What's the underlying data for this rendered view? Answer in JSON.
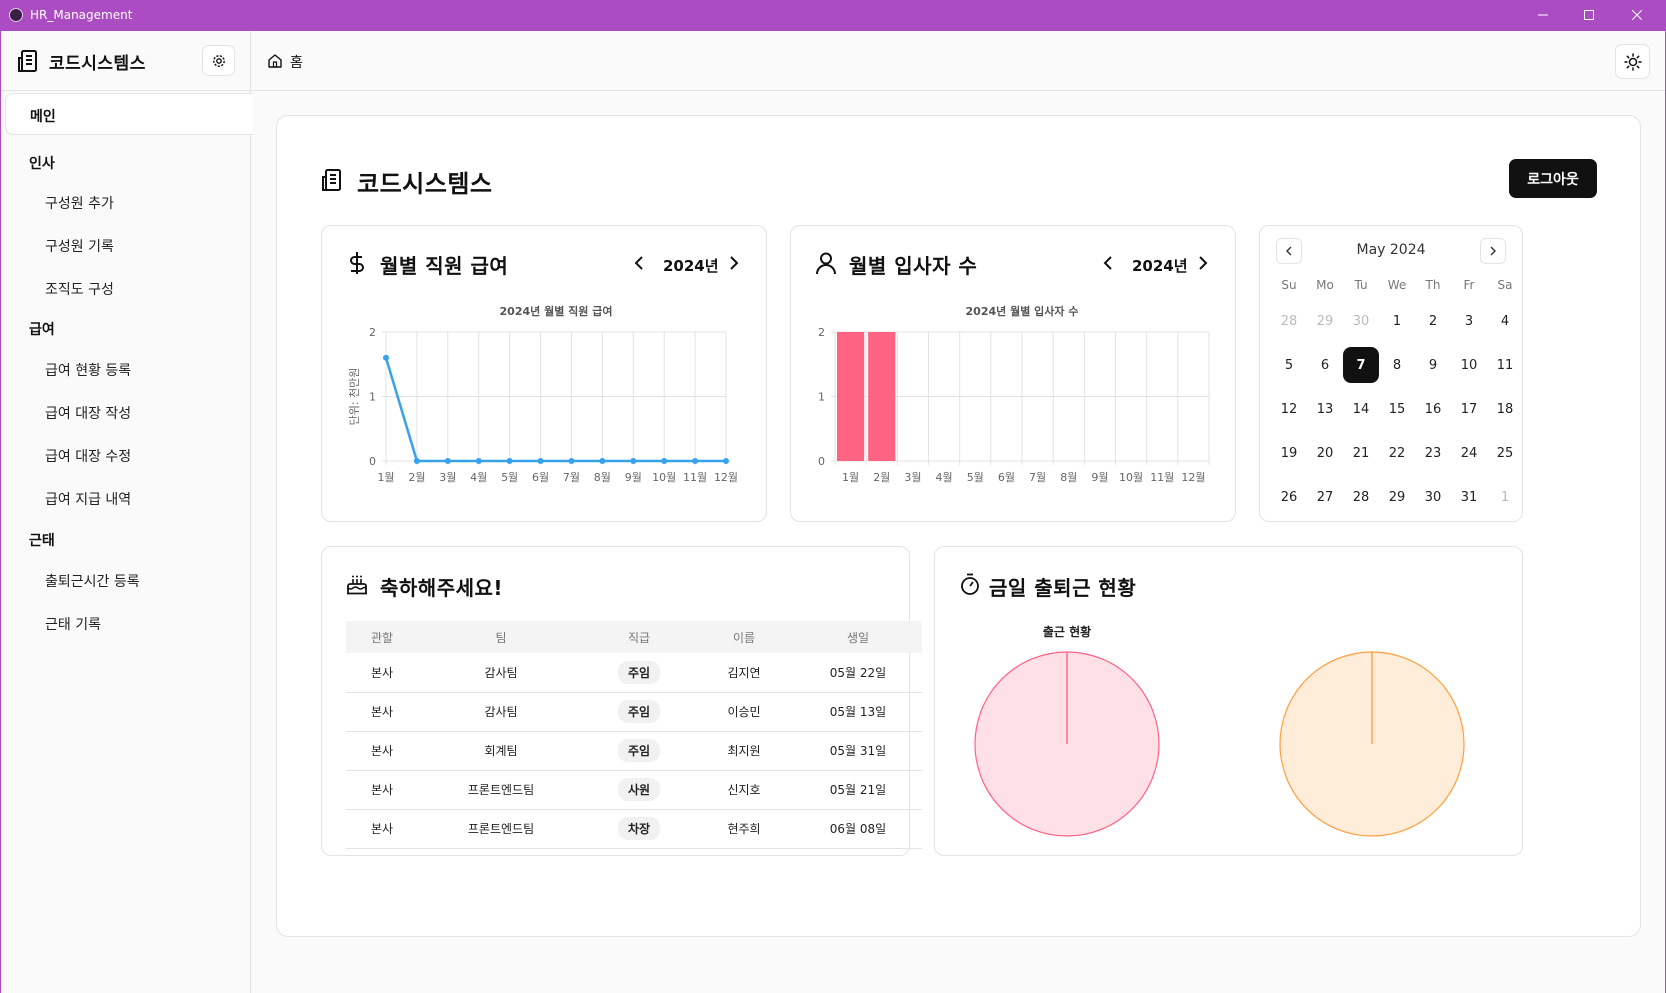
{
  "window": {
    "title": "HR_Management"
  },
  "sidebar": {
    "brand": "코드시스템스",
    "main_item": "메인",
    "sections": [
      {
        "label": "인사",
        "items": [
          "구성원 추가",
          "구성원 기록",
          "조직도 구성"
        ]
      },
      {
        "label": "급여",
        "items": [
          "급여 현황 등록",
          "급여 대장 작성",
          "급여 대장 수정",
          "급여 지급 내역"
        ]
      },
      {
        "label": "근태",
        "items": [
          "출퇴근시간 등록",
          "근태 기록"
        ]
      }
    ]
  },
  "topbar": {
    "breadcrumb": "홈"
  },
  "main": {
    "title": "코드시스템스",
    "logout_label": "로그아웃"
  },
  "salary_card": {
    "title": "월별 직원 급여",
    "year": "2024년"
  },
  "hire_card": {
    "title": "월별 입사자 수",
    "year": "2024년"
  },
  "calendar": {
    "month_label": "May 2024",
    "weekdays": [
      "Su",
      "Mo",
      "Tu",
      "We",
      "Th",
      "Fr",
      "Sa"
    ],
    "weeks": [
      [
        "28",
        "29",
        "30",
        "1",
        "2",
        "3",
        "4"
      ],
      [
        "5",
        "6",
        "7",
        "8",
        "9",
        "10",
        "11"
      ],
      [
        "12",
        "13",
        "14",
        "15",
        "16",
        "17",
        "18"
      ],
      [
        "19",
        "20",
        "21",
        "22",
        "23",
        "24",
        "25"
      ],
      [
        "26",
        "27",
        "28",
        "29",
        "30",
        "31",
        "1"
      ]
    ],
    "selected_day": "7"
  },
  "birthday_card": {
    "title": "축하해주세요!",
    "columns": [
      "관할",
      "팀",
      "직급",
      "이름",
      "생일"
    ],
    "rows": [
      [
        "본사",
        "감사팀",
        "주임",
        "김지연",
        "05월 22일"
      ],
      [
        "본사",
        "감사팀",
        "주임",
        "이승민",
        "05월 13일"
      ],
      [
        "본사",
        "회계팀",
        "주임",
        "최지원",
        "05월 31일"
      ],
      [
        "본사",
        "프론트엔드팀",
        "사원",
        "신지호",
        "05월 21일"
      ],
      [
        "본사",
        "프론트엔드팀",
        "차장",
        "현주희",
        "06월 08일"
      ]
    ]
  },
  "attendance_card": {
    "title": "금일 출퇴근 현황"
  },
  "colors": {
    "titlebar": "#ab4cc3",
    "line_series": "#36a2eb",
    "bar_series": "#ff6384",
    "pie_left_fill": "#ffe0e6",
    "pie_left_stroke": "#ff6384",
    "pie_right_fill": "#ffecd9",
    "pie_right_stroke": "#ff9f40"
  },
  "chart_data": [
    {
      "type": "line",
      "title": "2024년 월별 직원 급여",
      "ylabel": "단위: 천만원",
      "categories": [
        "1월",
        "2월",
        "3월",
        "4월",
        "5월",
        "6월",
        "7월",
        "8월",
        "9월",
        "10월",
        "11월",
        "12월"
      ],
      "values": [
        1.6,
        0,
        0,
        0,
        0,
        0,
        0,
        0,
        0,
        0,
        0,
        0
      ],
      "ylim": [
        0,
        2
      ],
      "yticks": [
        0,
        1,
        2
      ],
      "grid": true
    },
    {
      "type": "bar",
      "title": "2024년 월별 입사자 수",
      "categories": [
        "1월",
        "2월",
        "3월",
        "4월",
        "5월",
        "6월",
        "7월",
        "8월",
        "9월",
        "10월",
        "11월",
        "12월"
      ],
      "values": [
        2,
        2,
        0,
        0,
        0,
        0,
        0,
        0,
        0,
        0,
        0,
        0
      ],
      "ylim": [
        0,
        2
      ],
      "yticks": [
        0,
        1,
        2
      ],
      "grid": true
    },
    {
      "type": "pie",
      "title": "출근 현황",
      "values": [
        1
      ]
    },
    {
      "type": "pie",
      "title": "",
      "values": [
        1
      ]
    }
  ]
}
